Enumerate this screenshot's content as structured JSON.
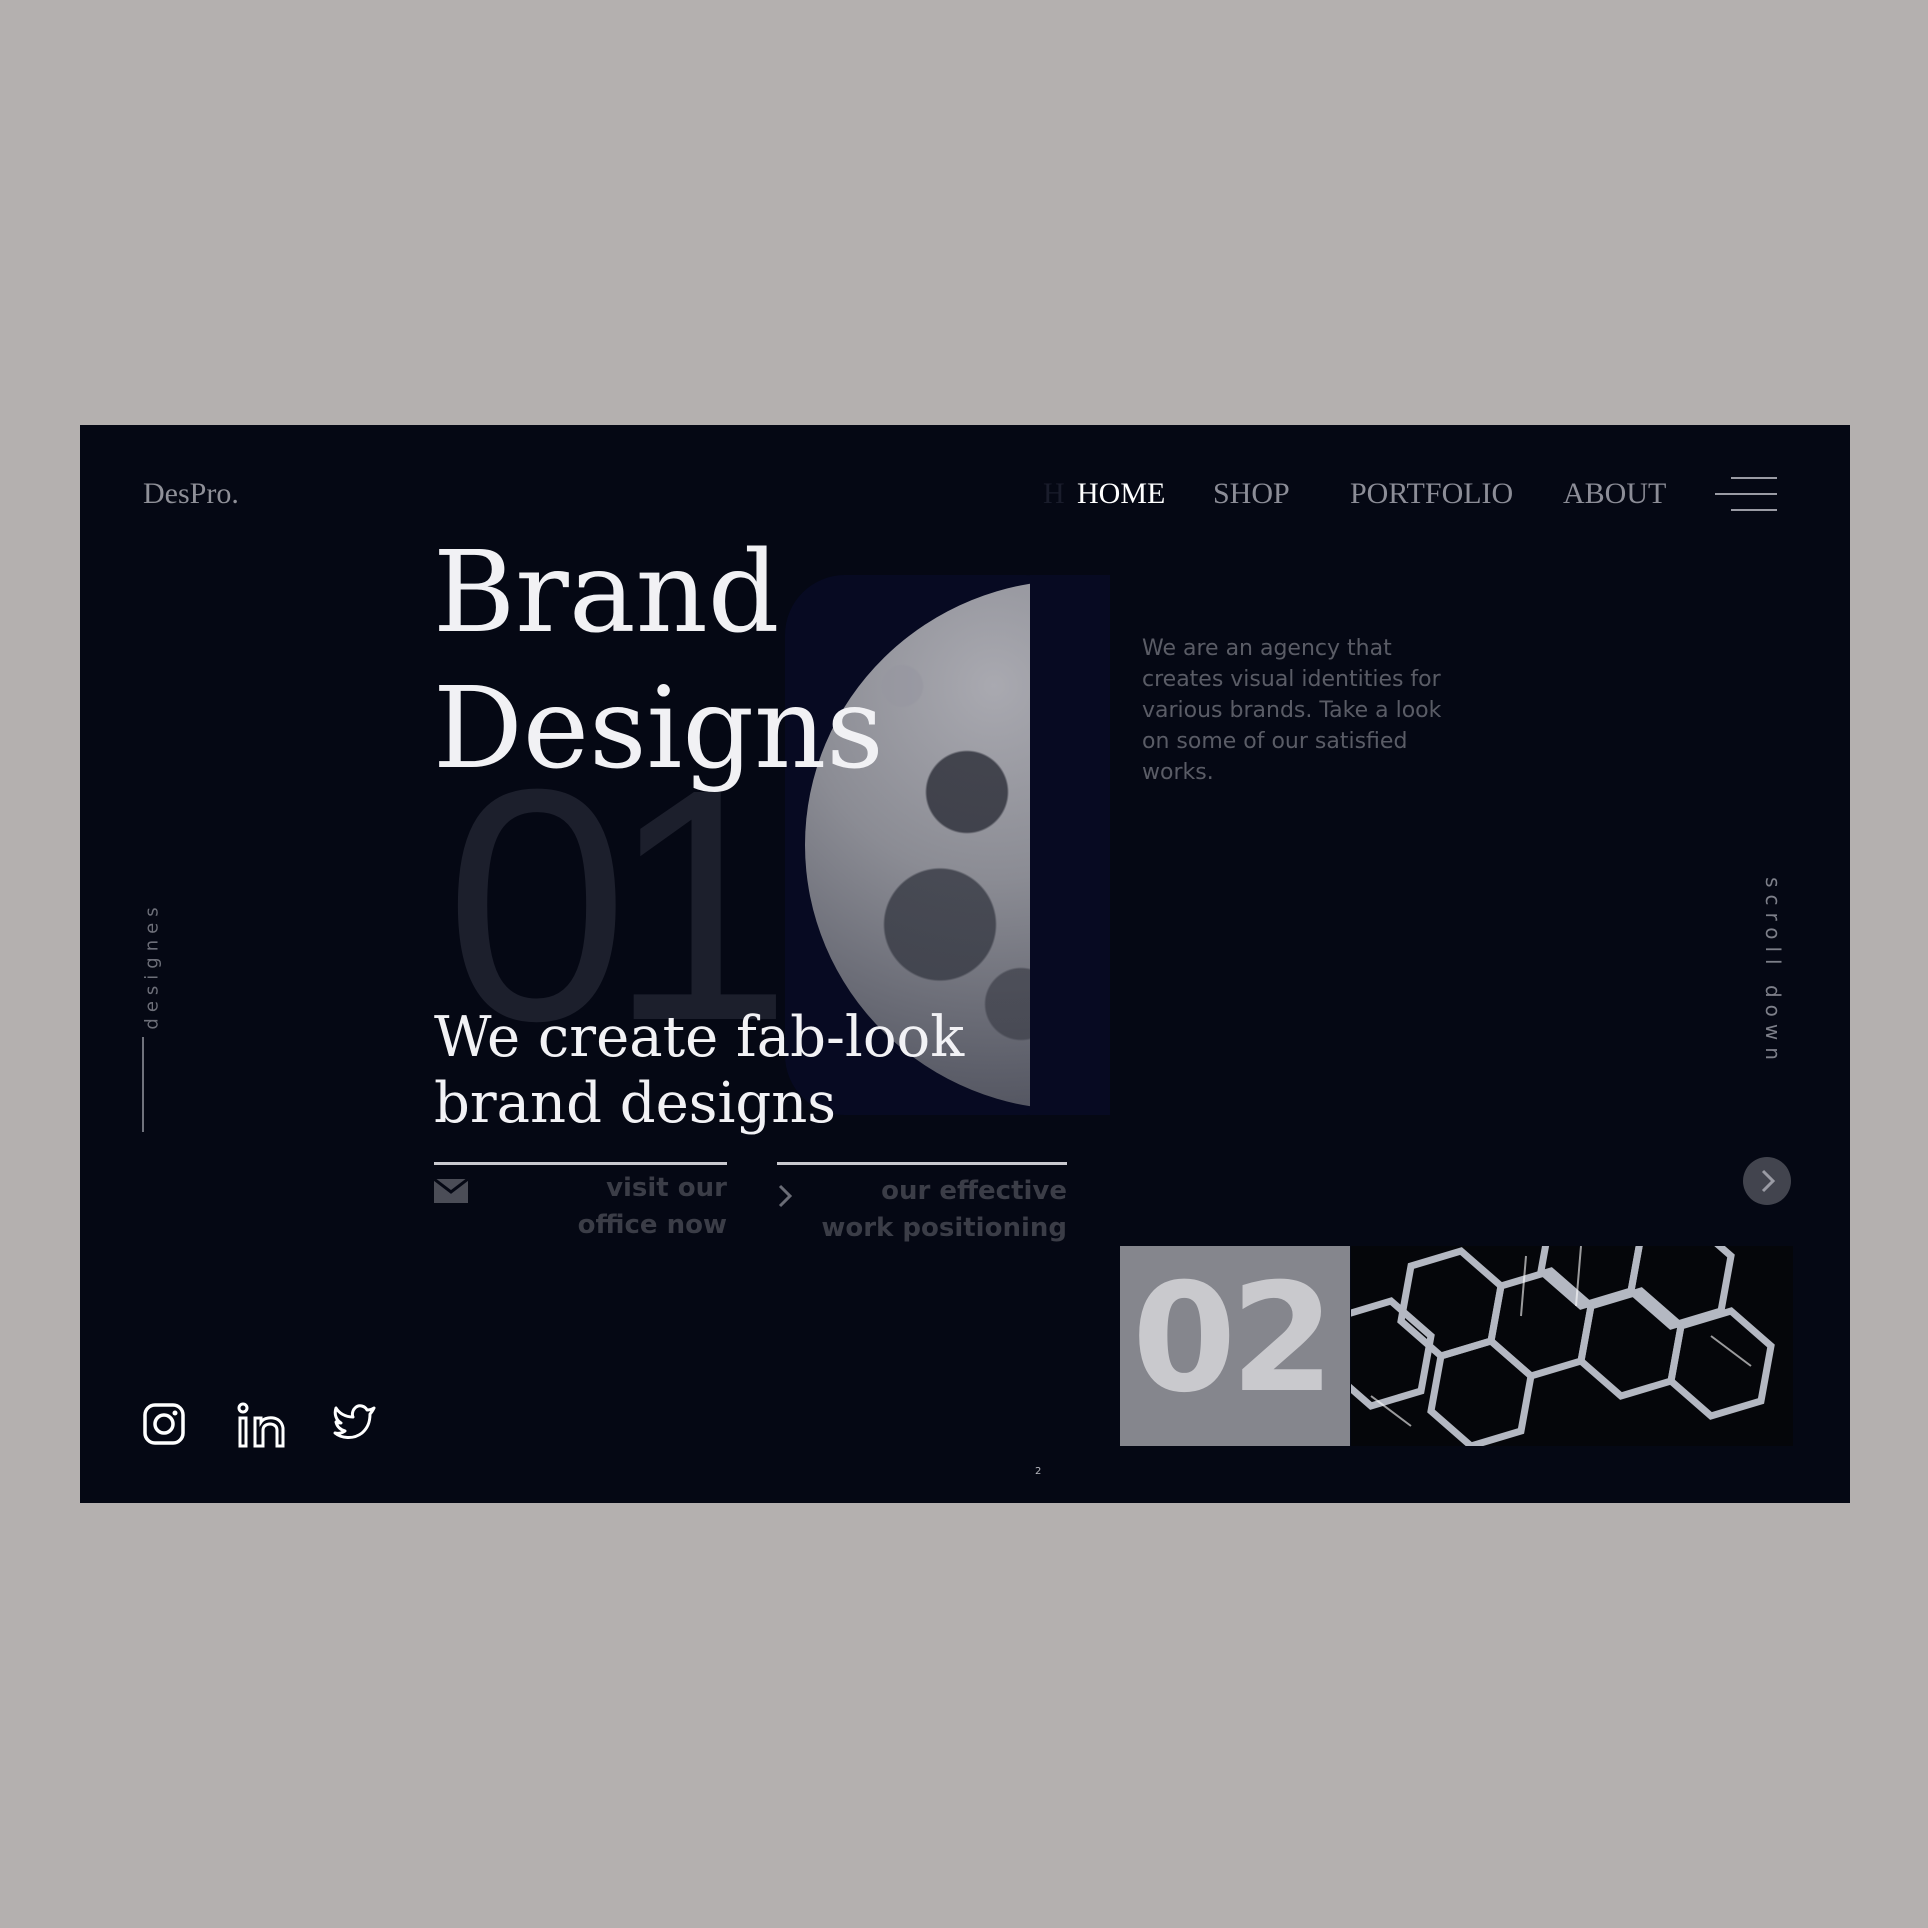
{
  "brand": {
    "logo": "DesPro."
  },
  "nav": {
    "items": [
      {
        "label": "HOME",
        "active": true
      },
      {
        "label": "SHOP",
        "active": false
      },
      {
        "label": "PORTFOLIO",
        "active": false
      },
      {
        "label": "ABOUT",
        "active": false
      }
    ]
  },
  "hero": {
    "title_line1": "Brand",
    "title_line2": "Designs",
    "background_number": "01",
    "subtitle_line1": "We create fab-look",
    "subtitle_line2": "brand designs",
    "description": "We are an agency that creates visual identities for various brands. Take a look on some of our satisfied works."
  },
  "cta": [
    {
      "icon": "mail-icon",
      "line1": "visit our",
      "line2": "office now"
    },
    {
      "icon": "chevron-right-icon",
      "line1": "our effective",
      "line2": "work positioning"
    }
  ],
  "side": {
    "left_label": "designes",
    "right_label": "scroll down"
  },
  "card": {
    "number": "02"
  },
  "social": [
    "instagram-icon",
    "linkedin-icon",
    "twitter-icon"
  ],
  "footer": {
    "page_number": "2"
  },
  "colors": {
    "background": "#050814",
    "page_bg": "#b4b0af",
    "text_primary": "#f1f1f4",
    "text_muted": "#8c8d97",
    "card_number_bg": "#85868d"
  }
}
